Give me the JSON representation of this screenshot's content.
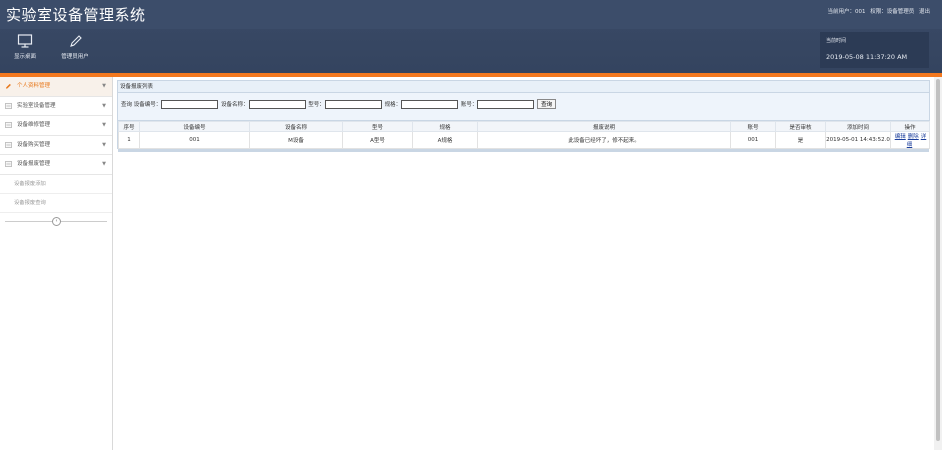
{
  "header": {
    "title": "实验室设备管理系统",
    "user_label": "当前用户：001",
    "role_label": "权限：设备管理员",
    "logout": "退出"
  },
  "toolbar": {
    "desktop": {
      "label": "显示桌面",
      "icon": "monitor-icon"
    },
    "admin": {
      "label": "管理员用户",
      "icon": "pencil-icon"
    }
  },
  "clock": {
    "label": "当前时间",
    "value": "2019-05-08 11:37:20 AM"
  },
  "sidebar": {
    "items": [
      {
        "label": "个人资料管理",
        "icon": "pencil-icon"
      },
      {
        "label": "实验室设备管理",
        "icon": "list-icon"
      },
      {
        "label": "设备维修管理",
        "icon": "list-icon"
      },
      {
        "label": "设备购买管理",
        "icon": "list-icon"
      },
      {
        "label": "设备报废管理",
        "icon": "list-icon"
      }
    ],
    "subitems": [
      "设备报废添加",
      "设备报废查询"
    ],
    "collapse_icon": "chevron-left-icon"
  },
  "panel": {
    "title": "设备报废列表"
  },
  "search": {
    "query_label": "查询",
    "fields": [
      "设备编号：",
      "设备名称：",
      "型号：",
      "规格：",
      "账号："
    ],
    "button": "查询"
  },
  "table": {
    "headers": [
      "序号",
      "设备编号",
      "设备名称",
      "型号",
      "规格",
      "报废说明",
      "账号",
      "是否审核",
      "添加时间",
      "操作"
    ],
    "rows": [
      {
        "cells": [
          "1",
          "001",
          "M设备",
          "A型号",
          "A规格",
          "此设备已经坏了，修不起来。",
          "001",
          "是",
          "2019-05-01 14:43:52.0"
        ],
        "actions": [
          "编辑",
          "删除",
          "详细"
        ]
      }
    ]
  },
  "colors": {
    "header_bg": "#3c4d6a",
    "accent": "#f3781e",
    "active_nav": "#e8791d",
    "link": "#1a3d9b"
  }
}
